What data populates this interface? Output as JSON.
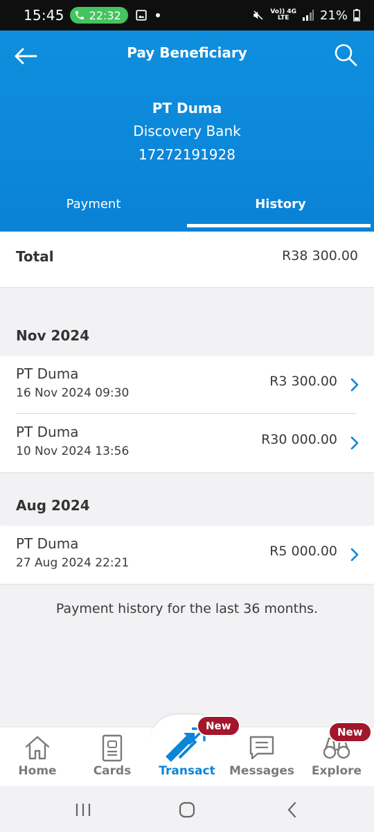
{
  "status_bar": {
    "time": "15:45",
    "call_timer": "22:32",
    "network_top": "Vo)) 4G",
    "network_bottom": "LTE",
    "battery": "21%"
  },
  "header": {
    "title": "Pay Beneficiary",
    "beneficiary_name": "PT Duma",
    "bank": "Discovery Bank",
    "account_number": "17272191928",
    "icons": {
      "back": "arrow-left",
      "search": "search"
    }
  },
  "tabs": [
    {
      "label": "Payment",
      "active": false
    },
    {
      "label": "History",
      "active": true
    }
  ],
  "total": {
    "label": "Total",
    "value": "R38 300.00"
  },
  "groups": [
    {
      "month": "Nov 2024",
      "transactions": [
        {
          "name": "PT Duma",
          "date": "16 Nov 2024 09:30",
          "amount": "R3 300.00"
        },
        {
          "name": "PT Duma",
          "date": "10 Nov 2024 13:56",
          "amount": "R30 000.00"
        }
      ]
    },
    {
      "month": "Aug 2024",
      "transactions": [
        {
          "name": "PT Duma",
          "date": "27 Aug 2024 22:21",
          "amount": "R5 000.00"
        }
      ]
    }
  ],
  "footnote": "Payment history for the last 36 months.",
  "bottom_nav": {
    "items": [
      {
        "label": "Home",
        "icon": "home",
        "active": false
      },
      {
        "label": "Cards",
        "icon": "card",
        "active": false
      },
      {
        "label": "Transact",
        "icon": "transfer-arrows",
        "active": true,
        "badge": "New"
      },
      {
        "label": "Messages",
        "icon": "message",
        "active": false
      },
      {
        "label": "Explore",
        "icon": "binoculars",
        "active": false,
        "badge": "New"
      }
    ]
  },
  "colors": {
    "header_blue": "#0a82d6",
    "accent": "#0b85d8",
    "badge": "#a3162b",
    "call_green": "#45c35e"
  }
}
